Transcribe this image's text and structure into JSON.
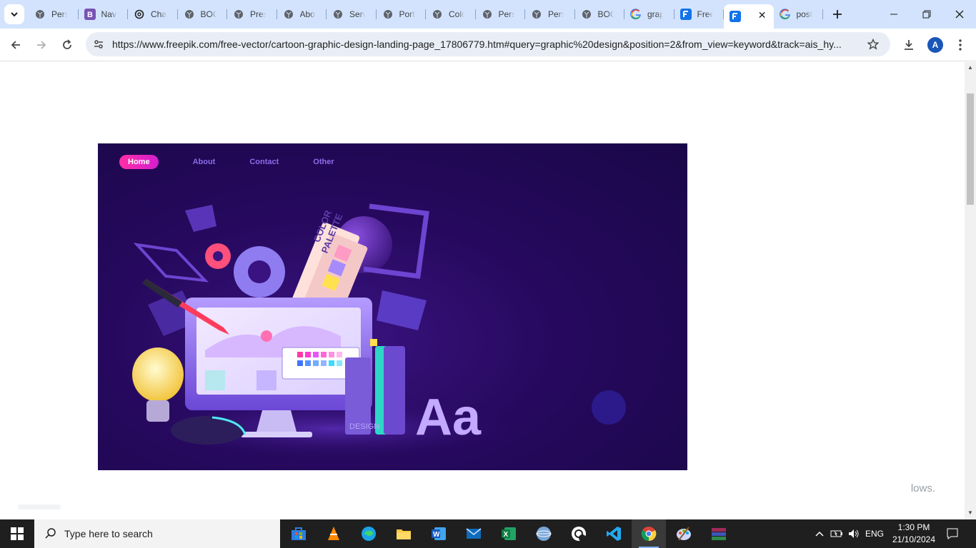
{
  "browser": {
    "tabs": [
      {
        "title": "Pers",
        "favicon": "globe-icon"
      },
      {
        "title": "Navi",
        "favicon": "bootstrap-icon"
      },
      {
        "title": "Chat",
        "favicon": "chatgpt-icon"
      },
      {
        "title": "BOO",
        "favicon": "globe-icon"
      },
      {
        "title": "Pres",
        "favicon": "globe-icon"
      },
      {
        "title": "Abo",
        "favicon": "globe-icon"
      },
      {
        "title": "Serv",
        "favicon": "globe-icon"
      },
      {
        "title": "Port",
        "favicon": "globe-icon"
      },
      {
        "title": "Colo",
        "favicon": "globe-icon"
      },
      {
        "title": "Pers",
        "favicon": "globe-icon"
      },
      {
        "title": "Pers",
        "favicon": "globe-icon"
      },
      {
        "title": "BOO",
        "favicon": "globe-icon"
      },
      {
        "title": "grap",
        "favicon": "google-icon"
      },
      {
        "title": "Free",
        "favicon": "freepik-icon"
      },
      {
        "title": "",
        "favicon": "freepik-icon",
        "active": true
      },
      {
        "title": "post",
        "favicon": "google-icon"
      }
    ],
    "url": "https://www.freepik.com/free-vector/cartoon-graphic-design-landing-page_17806779.htm#query=graphic%20design&position=2&from_view=keyword&track=ais_hy...",
    "profile_initial": "A"
  },
  "page": {
    "hero_nav": {
      "home": "Home",
      "about": "About",
      "contact": "Contact",
      "other": "Other"
    },
    "illustration": {
      "palette_label_line1": "COLOR",
      "palette_label_line2": "PALETTE",
      "book_label": "DESIGN",
      "letters": "Aa"
    },
    "snippet_text": "lows."
  },
  "taskbar": {
    "search_placeholder": "Type here to search",
    "language": "ENG",
    "time": "1:30 PM",
    "date": "21/10/2024"
  },
  "colors": {
    "tabbar": "#d3e3fd",
    "hero_bg": "#26095e",
    "accent_pink": "#ff2fa4",
    "nav_link": "#8d6be8"
  }
}
